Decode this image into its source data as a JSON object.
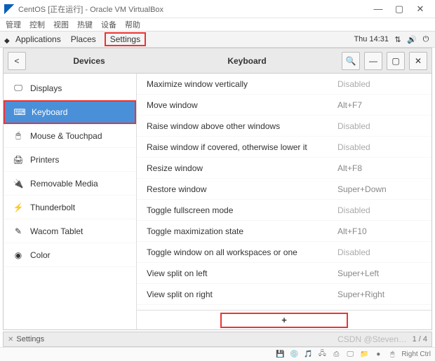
{
  "vbox": {
    "title": "CentOS [正在运行] - Oracle VM VirtualBox",
    "menu": [
      "管理",
      "控制",
      "视图",
      "热键",
      "设备",
      "帮助"
    ],
    "host_key": "Right Ctrl"
  },
  "gnome_top": {
    "applications": "Applications",
    "places": "Places",
    "settings": "Settings",
    "time": "Thu 14:31"
  },
  "app": {
    "back_label": "<",
    "sidebar_title": "Devices",
    "main_title": "Keyboard",
    "win": {
      "min": "—",
      "max": "▢",
      "close": "✕"
    }
  },
  "sidebar": {
    "items": [
      {
        "icon": "🖵",
        "label": "Displays"
      },
      {
        "icon": "⌨",
        "label": "Keyboard"
      },
      {
        "icon": "🖱",
        "label": "Mouse & Touchpad"
      },
      {
        "icon": "🖨",
        "label": "Printers"
      },
      {
        "icon": "🔌",
        "label": "Removable Media"
      },
      {
        "icon": "⚡",
        "label": "Thunderbolt"
      },
      {
        "icon": "✎",
        "label": "Wacom Tablet"
      },
      {
        "icon": "◉",
        "label": "Color"
      }
    ]
  },
  "shortcuts": [
    {
      "label": "Maximize window vertically",
      "accel": "Disabled",
      "disabled": true
    },
    {
      "label": "Move window",
      "accel": "Alt+F7"
    },
    {
      "label": "Raise window above other windows",
      "accel": "Disabled",
      "disabled": true
    },
    {
      "label": "Raise window if covered, otherwise lower it",
      "accel": "Disabled",
      "disabled": true
    },
    {
      "label": "Resize window",
      "accel": "Alt+F8"
    },
    {
      "label": "Restore window",
      "accel": "Super+Down"
    },
    {
      "label": "Toggle fullscreen mode",
      "accel": "Disabled",
      "disabled": true
    },
    {
      "label": "Toggle maximization state",
      "accel": "Alt+F10"
    },
    {
      "label": "Toggle window on all workspaces or one",
      "accel": "Disabled",
      "disabled": true
    },
    {
      "label": "View split on left",
      "accel": "Super+Left"
    },
    {
      "label": "View split on right",
      "accel": "Super+Right"
    }
  ],
  "add_label": "+",
  "taskbar": {
    "app": "Settings",
    "page": "1 / 4"
  },
  "watermark": "CSDN @Steven…"
}
